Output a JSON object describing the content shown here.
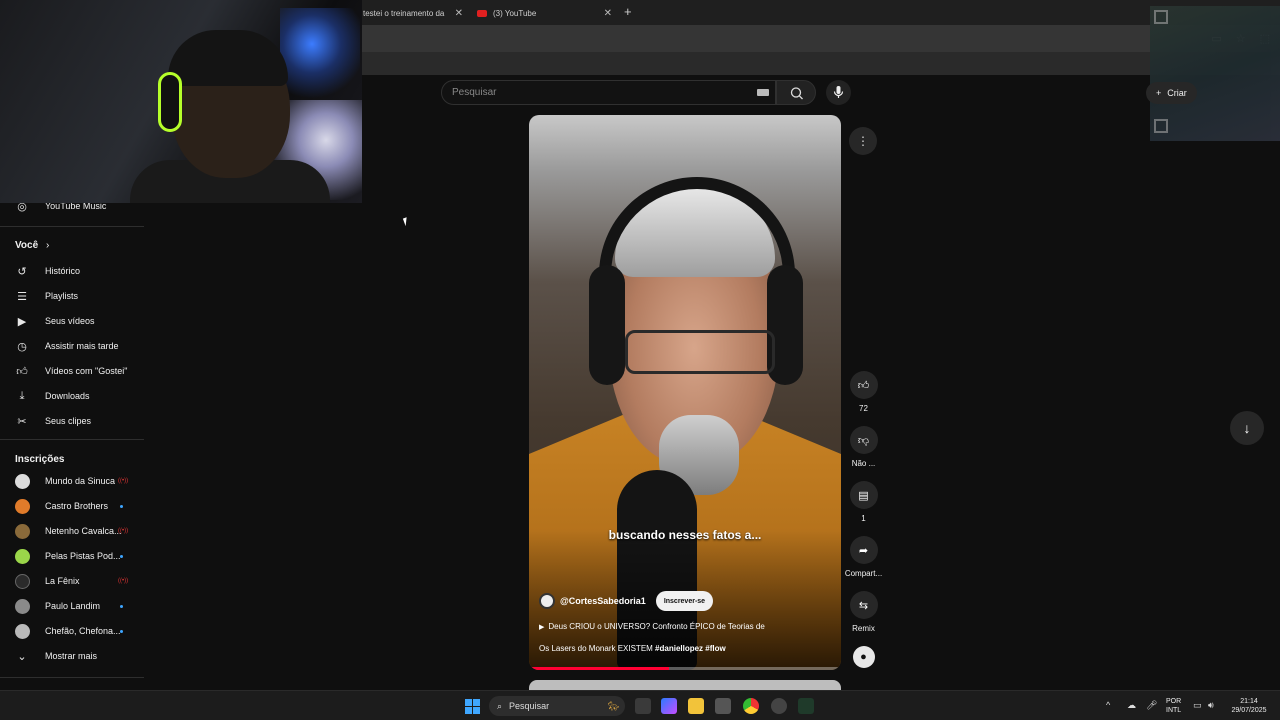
{
  "browser": {
    "tabs": [
      {
        "label": "testei o treinamento da"
      },
      {
        "label": "(3) YouTube"
      }
    ],
    "new_tab_glyph": "+",
    "close_glyph": "✕"
  },
  "header": {
    "search_placeholder": "Pesquisar",
    "create_label": "Criar"
  },
  "sidebar": {
    "top_item": "YouTube Music",
    "you_heading": "Você",
    "you_items": [
      {
        "label": "Histórico",
        "icon": "history-icon"
      },
      {
        "label": "Playlists",
        "icon": "playlists-icon"
      },
      {
        "label": "Seus vídeos",
        "icon": "your-videos-icon"
      },
      {
        "label": "Assistir mais tarde",
        "icon": "watch-later-icon"
      },
      {
        "label": "Vídeos com \"Gostei\"",
        "icon": "thumb-up-icon"
      },
      {
        "label": "Downloads",
        "icon": "download-icon"
      },
      {
        "label": "Seus clipes",
        "icon": "scissors-icon"
      }
    ],
    "subs_heading": "Inscrições",
    "subscriptions": [
      {
        "label": "Mundo da Sinuca",
        "color": "#dcdcdc"
      },
      {
        "label": "Castro Brothers",
        "color": "#e07b2a"
      },
      {
        "label": "Netenho Cavalca...",
        "color": "#8a6a3a"
      },
      {
        "label": "Pelas Pistas Pod...",
        "color": "#9bd64a"
      },
      {
        "label": "La Fênix",
        "color": "#2a2a2a"
      },
      {
        "label": "Paulo Landim",
        "color": "#8a8a8a"
      },
      {
        "label": "Chefão, Chefona...",
        "color": "#b9b9b9"
      }
    ],
    "show_more": "Mostrar mais"
  },
  "short": {
    "caption": "buscando nesses fatos a...",
    "channel": "@CortesSabedoria1",
    "subscribe": "Inscrever-se",
    "title_line1": "Deus CRIOU o UNIVERSO? Confronto ÉPICO de Teorias de",
    "title_line2_text": "Os Lasers do Monark EXISTEM ",
    "title_line2_tags": "#daniellopez #flow",
    "progress": 0.45
  },
  "actions": {
    "like_count": "72",
    "dislike_label": "Não ...",
    "comment_count": "1",
    "share_label": "Compart...",
    "remix_label": "Remix"
  },
  "taskbar": {
    "search_label": "Pesquisar",
    "lang_line1": "POR",
    "lang_line2": "INTL",
    "time": "21:14",
    "date": "29/07/2025"
  },
  "colors": {
    "accent_red": "#ff0033",
    "link_blue": "#3ea6ff"
  }
}
